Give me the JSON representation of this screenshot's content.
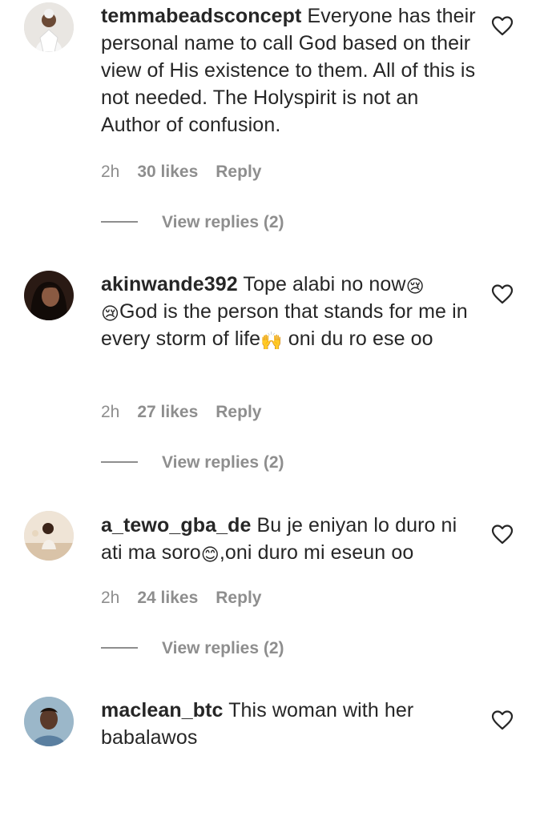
{
  "comments": [
    {
      "username": "temmabeadsconcept",
      "text_parts": [
        "Everyone has their personal name to call God based on their view of His existence to them. All of this is not needed. The Holyspirit is not an Author of confusion."
      ],
      "time": "2h",
      "likes": "30 likes",
      "reply": "Reply",
      "view_replies": "View replies (2)"
    },
    {
      "username": "akinwande392",
      "text_parts": [
        "Tope alabi no now",
        "God is the person that stands for me in every storm of life",
        " oni du ro ese oo"
      ],
      "emojis": [
        "😢",
        "😢",
        "🙌"
      ],
      "time": "2h",
      "likes": "27 likes",
      "reply": "Reply",
      "view_replies": "View replies (2)"
    },
    {
      "username": "a_tewo_gba_de",
      "text_parts": [
        "Bu je eniyan lo duro ni ati ma soro",
        ",oni duro mi eseun oo"
      ],
      "emojis": [
        "😊"
      ],
      "time": "2h",
      "likes": "24 likes",
      "reply": "Reply",
      "view_replies": "View replies (2)"
    },
    {
      "username": "maclean_btc",
      "text_parts": [
        "This woman with her babalawos"
      ]
    }
  ],
  "icons": {
    "like": "heart-outline-icon"
  },
  "colors": {
    "text": "#262626",
    "secondary": "#8e8e8e",
    "background": "#ffffff"
  }
}
